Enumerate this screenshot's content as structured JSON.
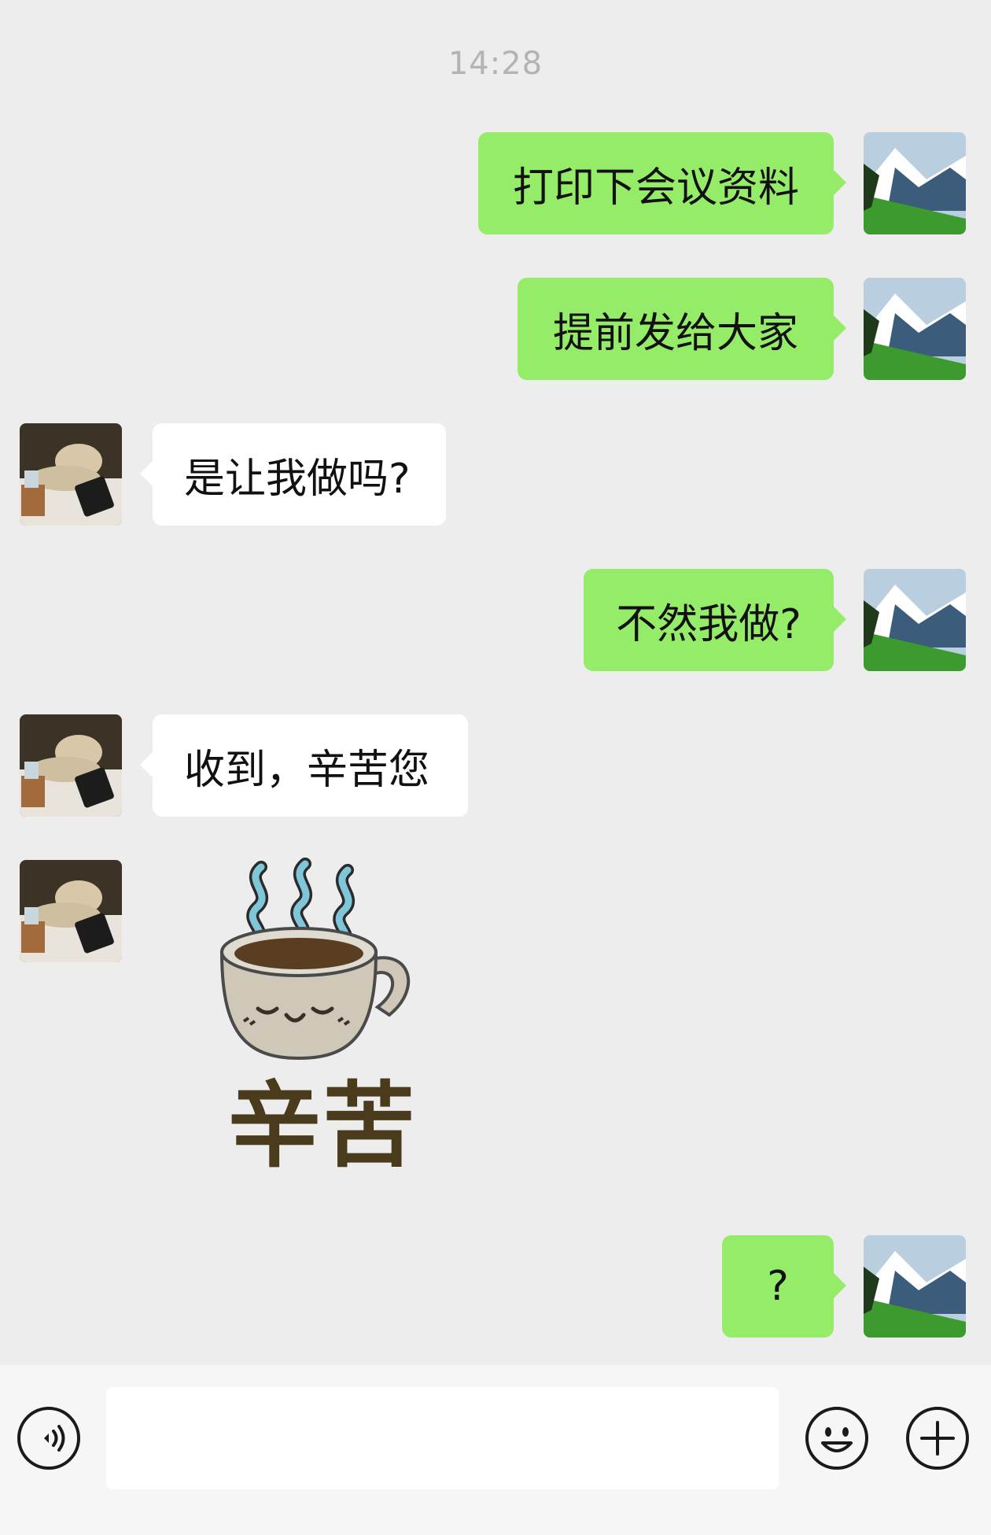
{
  "chat": {
    "timestamp": "14:28",
    "messages": [
      {
        "direction": "outgoing",
        "type": "text",
        "text": "打印下会议资料"
      },
      {
        "direction": "outgoing",
        "type": "text",
        "text": "提前发给大家"
      },
      {
        "direction": "incoming",
        "type": "text",
        "text": "是让我做吗?"
      },
      {
        "direction": "outgoing",
        "type": "text",
        "text": "不然我做?"
      },
      {
        "direction": "incoming",
        "type": "text",
        "text": "收到，辛苦您"
      },
      {
        "direction": "incoming",
        "type": "sticker",
        "text": "辛苦",
        "sticker_icon": "coffee-cup-icon"
      },
      {
        "direction": "outgoing",
        "type": "text",
        "text": "?"
      }
    ]
  },
  "input_bar": {
    "voice_icon": "voice-icon",
    "emoji_icon": "emoji-icon",
    "plus_icon": "plus-icon"
  },
  "colors": {
    "background": "#ededed",
    "outgoing_bubble": "#95ec69",
    "incoming_bubble": "#ffffff",
    "timestamp": "#b3b3b3"
  }
}
